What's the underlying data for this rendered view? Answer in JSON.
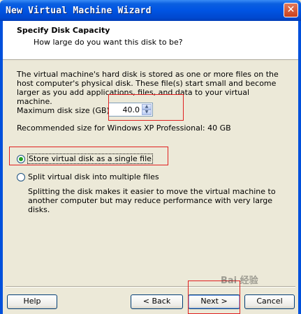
{
  "window": {
    "title": "New Virtual Machine Wizard",
    "close_glyph": "✕"
  },
  "header": {
    "title": "Specify Disk Capacity",
    "subtitle": "How large do you want this disk to be?"
  },
  "body": {
    "description": "The virtual machine's hard disk is stored as one or more files on the host computer's physical disk. These file(s) start small and become larger as you add applications, files, and data to your virtual machine.",
    "max_size_label": "Maximum disk size (GB):",
    "max_size_value": "40.0",
    "recommended": "Recommended size for Windows XP Professional: 40 GB",
    "option_single": "Store virtual disk as a single file",
    "option_split": "Split virtual disk into multiple files",
    "split_description": "Splitting the disk makes it easier to move the virtual machine to another computer but may reduce performance with very large disks.",
    "selected_option": "single"
  },
  "buttons": {
    "help": "Help",
    "back": "< Back",
    "next": "Next >",
    "cancel": "Cancel"
  },
  "watermark": "Bai 经验",
  "colors": {
    "title_bar": "#0054e3",
    "annotation": "#e02020",
    "radio_dot": "#21a121"
  }
}
